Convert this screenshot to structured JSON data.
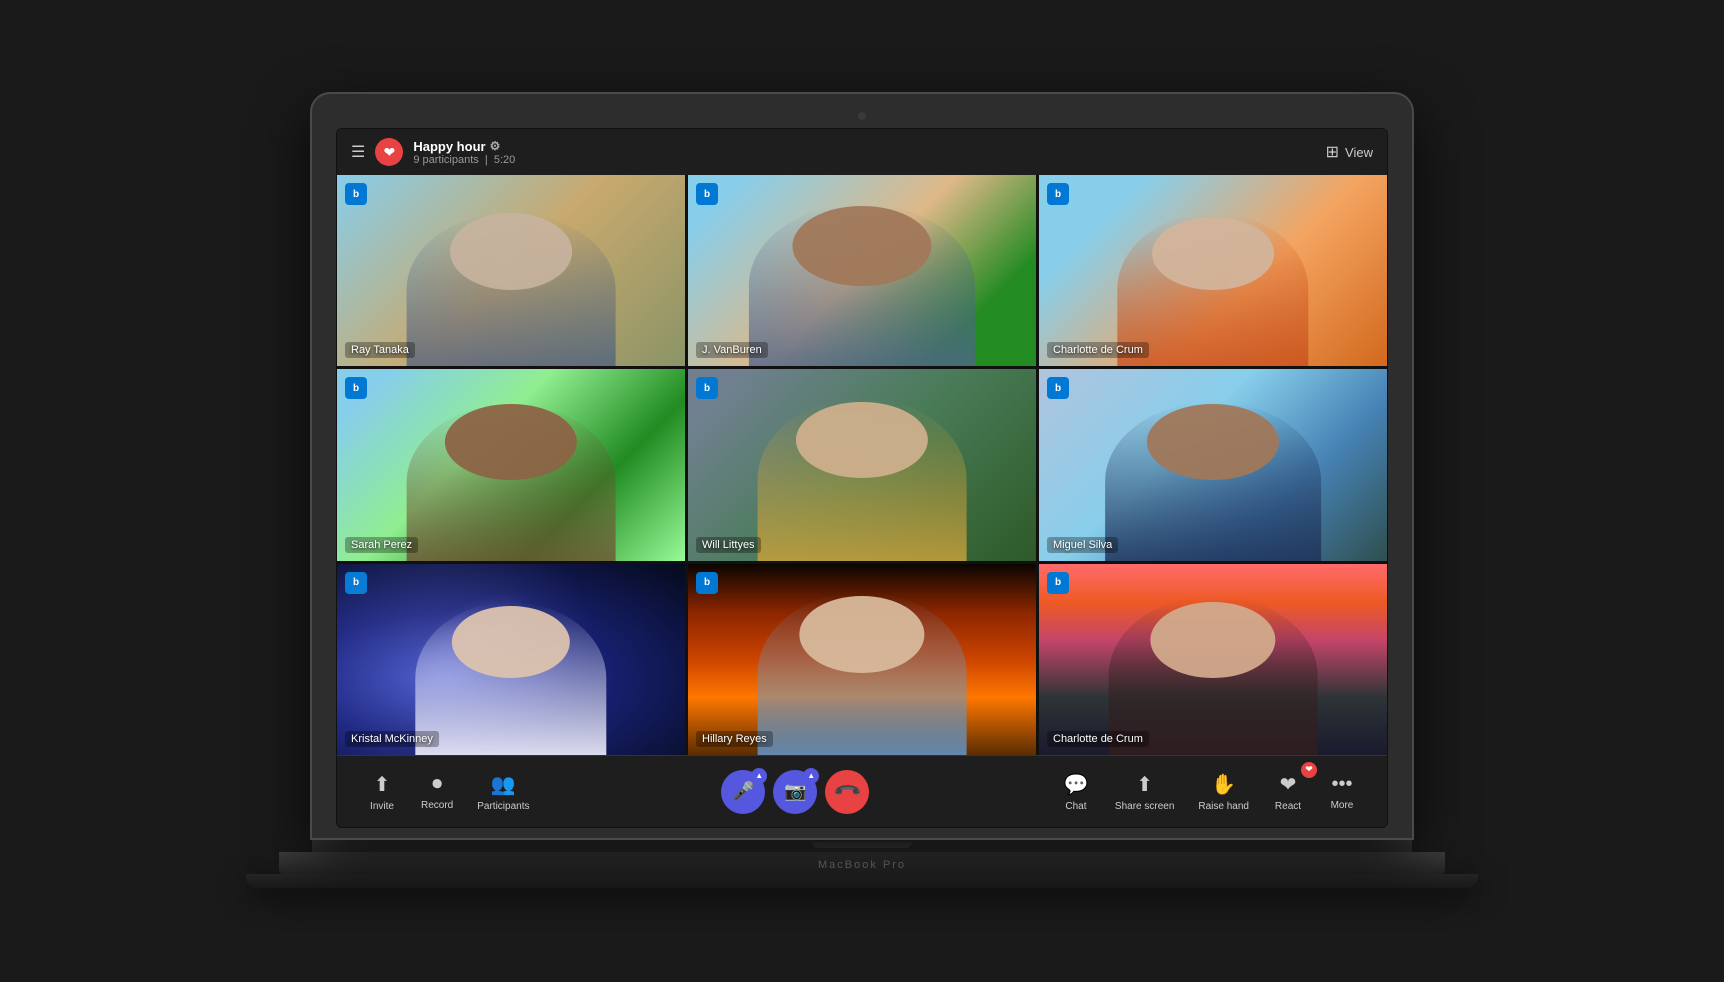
{
  "meeting": {
    "title": "Happy hour",
    "participants": "9 participants",
    "duration": "5:20",
    "view_label": "View"
  },
  "toolbar": {
    "invite_label": "Invite",
    "record_label": "Record",
    "participants_label": "Participants",
    "chat_label": "Chat",
    "share_screen_label": "Share screen",
    "raise_hand_label": "Raise hand",
    "react_label": "React",
    "more_label": "More"
  },
  "participants": [
    {
      "name": "Ray Tanaka",
      "cell": "cell-1",
      "id": 1
    },
    {
      "name": "J. VanBuren",
      "cell": "cell-2",
      "id": 2
    },
    {
      "name": "Charlotte de Crum",
      "cell": "cell-3",
      "id": 3
    },
    {
      "name": "Sarah Perez",
      "cell": "cell-4",
      "id": 4
    },
    {
      "name": "Will Littyes",
      "cell": "cell-5",
      "id": 5
    },
    {
      "name": "Miguel Silva",
      "cell": "cell-6",
      "id": 6
    },
    {
      "name": "Kristal McKinney",
      "cell": "cell-7",
      "id": 7
    },
    {
      "name": "Hillary Reyes",
      "cell": "cell-8",
      "id": 8
    },
    {
      "name": "Charlotte de Crum",
      "cell": "cell-9",
      "id": 9
    }
  ],
  "brand": "MacBook Pro",
  "icons": {
    "hamburger": "☰",
    "gear": "⚙",
    "grid": "⊞",
    "mic": "🎤",
    "camera": "📷",
    "hangup": "📞",
    "chat": "💬",
    "share": "⬆",
    "hand": "✋",
    "heart": "❤",
    "dots": "•••",
    "arrow_up": "▲",
    "person_plus": "👤",
    "record_circle": "⏺",
    "participants_icon": "👥"
  }
}
